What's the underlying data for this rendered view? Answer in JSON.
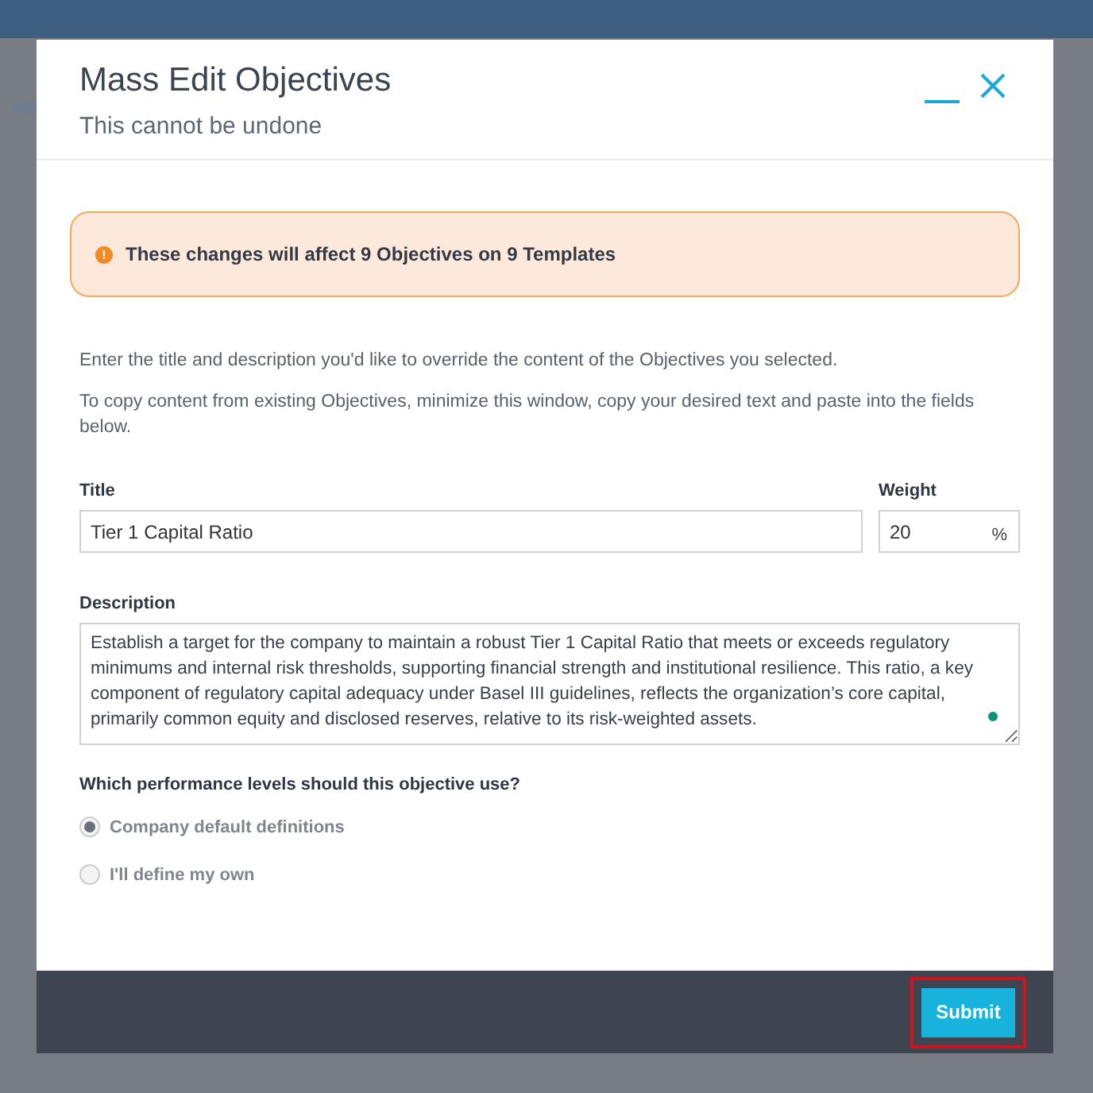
{
  "dialog": {
    "title": "Mass Edit Objectives",
    "subtitle": "This cannot be undone"
  },
  "warning": {
    "icon": "!",
    "text": "These changes will affect 9 Objectives on 9 Templates"
  },
  "instructions": [
    "Enter the title and description you'd like to override the content of the Objectives you selected.",
    "To copy content from existing Objectives, minimize this window, copy your desired text and paste into the fields below."
  ],
  "title_field": {
    "label": "Title",
    "value": "Tier 1 Capital Ratio"
  },
  "weight_field": {
    "label": "Weight",
    "value": "20",
    "unit": "%"
  },
  "description_field": {
    "label": "Description",
    "value": "Establish a target for the company to maintain a robust Tier 1 Capital Ratio that meets or exceeds regulatory minimums and internal risk thresholds, supporting financial strength and institutional resilience. This ratio, a key component of regulatory capital adequacy under Basel III guidelines, reflects the organization’s core capital, primarily common equity and disclosed reserves, relative to its risk-weighted assets."
  },
  "performance_levels": {
    "question": "Which performance levels should this objective use?",
    "options": [
      {
        "label": "Company default definitions",
        "selected": true
      },
      {
        "label": "I'll define my own",
        "selected": false
      }
    ]
  },
  "footer": {
    "submit": "Submit",
    "highlighted": true
  }
}
